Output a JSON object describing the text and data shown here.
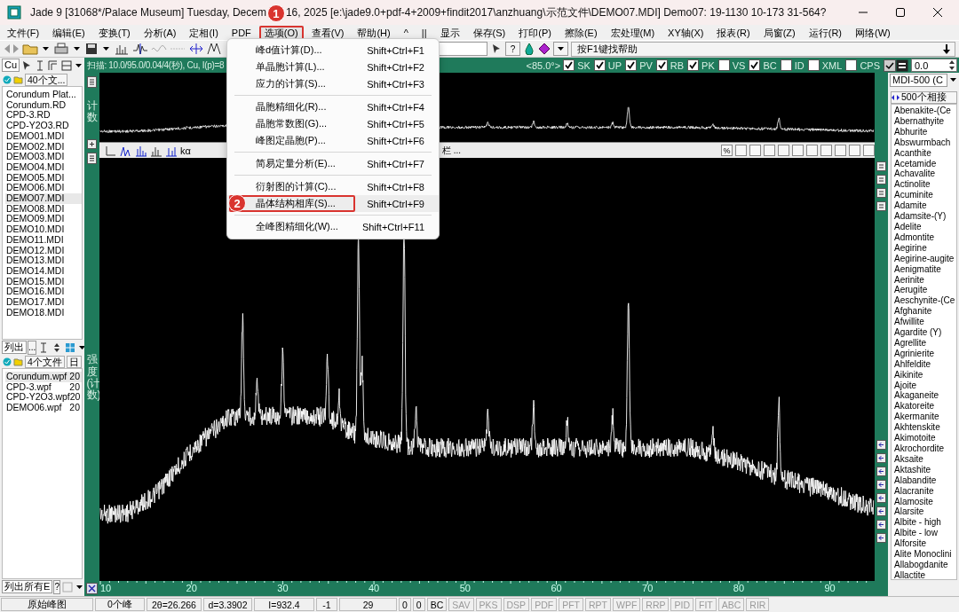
{
  "window": {
    "title": "Jade 9 [31068*/Palace Museum] Tuesday, Decem",
    "title_rest": "16, 2025 [e:\\jade9.0+pdf-4+2009+findit2017\\anzhuang\\示范文件\\DEMO07.MDI] Demo07: 19-1130 10-173 31-564?"
  },
  "menu_bar": [
    {
      "label": "文件(F)",
      "selected": false
    },
    {
      "label": "编辑(E)",
      "selected": false
    },
    {
      "label": "变换(T)",
      "selected": false
    },
    {
      "label": "分析(A)",
      "selected": false
    },
    {
      "label": "定相(I)",
      "selected": false
    },
    {
      "label": "PDF",
      "selected": false
    },
    {
      "label": "选项(O)",
      "selected": true,
      "callout": "1"
    },
    {
      "label": "查看(V)",
      "selected": false
    },
    {
      "label": "帮助(H)",
      "selected": false
    },
    {
      "label": "^",
      "selected": false
    },
    {
      "label": "||",
      "selected": false
    },
    {
      "label": "显示",
      "selected": false
    },
    {
      "label": "保存(S)",
      "selected": false
    },
    {
      "label": "打印(P)",
      "selected": false
    },
    {
      "label": "擦除(E)",
      "selected": false
    },
    {
      "label": "宏处理(M)",
      "selected": false
    },
    {
      "label": "XY轴(X)",
      "selected": false
    },
    {
      "label": "报表(R)",
      "selected": false
    },
    {
      "label": "局窗(Z)",
      "selected": false
    },
    {
      "label": "运行(R)",
      "selected": false
    },
    {
      "label": "网络(W)",
      "selected": false
    }
  ],
  "toolbar": {
    "help_button": "?",
    "help_text": "按F1键找帮助"
  },
  "options_menu": [
    {
      "kind": "item",
      "label": "峰d值计算(D)...",
      "shortcut": "Shift+Ctrl+F1",
      "selected": false
    },
    {
      "kind": "item",
      "label": "单晶胞计算(L)...",
      "shortcut": "Shift+Ctrl+F2",
      "selected": false
    },
    {
      "kind": "item",
      "label": "应力的计算(S)...",
      "shortcut": "Shift+Ctrl+F3",
      "selected": false
    },
    {
      "kind": "separator"
    },
    {
      "kind": "item",
      "label": "晶胞精细化(R)...",
      "shortcut": "Shift+Ctrl+F4",
      "selected": false
    },
    {
      "kind": "item",
      "label": "晶胞常数图(G)...",
      "shortcut": "Shift+Ctrl+F5",
      "selected": false
    },
    {
      "kind": "item",
      "label": "峰图定晶胞(P)...",
      "shortcut": "Shift+Ctrl+F6",
      "selected": false
    },
    {
      "kind": "separator"
    },
    {
      "kind": "item",
      "label": "简易定量分析(E)...",
      "shortcut": "Shift+Ctrl+F7",
      "selected": false
    },
    {
      "kind": "separator"
    },
    {
      "kind": "item",
      "label": "衍射图的计算(C)...",
      "shortcut": "Shift+Ctrl+F8",
      "selected": false
    },
    {
      "kind": "item",
      "label": "晶体结构相库(S)...",
      "shortcut": "Shift+Ctrl+F9",
      "selected": true,
      "callout": "2"
    },
    {
      "kind": "separator"
    },
    {
      "kind": "item",
      "label": "全峰图精细化(W)...",
      "shortcut": "Shift+Ctrl+F11",
      "selected": false
    }
  ],
  "scan_bar": {
    "info": "扫描: 10.0/95.0/0.04/4(秒), Cu, I(p)=8",
    "angle": "<85.0°>",
    "toggles": [
      {
        "label": "SK",
        "checked": true
      },
      {
        "label": "UP",
        "checked": true
      },
      {
        "label": "PV",
        "checked": true
      },
      {
        "label": "RB",
        "checked": true
      },
      {
        "label": "PK",
        "checked": true
      },
      {
        "label": "VS",
        "checked": false
      },
      {
        "label": "BC",
        "checked": true
      },
      {
        "label": "ID",
        "checked": false
      },
      {
        "label": "XML",
        "checked": false
      },
      {
        "label": "CPS",
        "checked": false
      }
    ],
    "value": "0.0"
  },
  "file_panel": {
    "radiation": "Cu",
    "header": "40个文...",
    "files": [
      {
        "name": "Corundum Plat...",
        "selected": false
      },
      {
        "name": "Corundum.RD",
        "selected": false
      },
      {
        "name": "CPD-3.RD",
        "selected": false
      },
      {
        "name": "CPD-Y2O3.RD",
        "selected": false
      },
      {
        "name": "DEMO01.MDI",
        "selected": false
      },
      {
        "name": "DEMO02.MDI",
        "selected": false
      },
      {
        "name": "DEMO03.MDI",
        "selected": false
      },
      {
        "name": "DEMO04.MDI",
        "selected": false
      },
      {
        "name": "DEMO05.MDI",
        "selected": false
      },
      {
        "name": "DEMO06.MDI",
        "selected": false
      },
      {
        "name": "DEMO07.MDI",
        "selected": true
      },
      {
        "name": "DEMO08.MDI",
        "selected": false
      },
      {
        "name": "DEMO09.MDI",
        "selected": false
      },
      {
        "name": "DEMO10.MDI",
        "selected": false
      },
      {
        "name": "DEMO11.MDI",
        "selected": false
      },
      {
        "name": "DEMO12.MDI",
        "selected": false
      },
      {
        "name": "DEMO13.MDI",
        "selected": false
      },
      {
        "name": "DEMO14.MDI",
        "selected": false
      },
      {
        "name": "DEMO15.MDI",
        "selected": false
      },
      {
        "name": "DEMO16.MDI",
        "selected": false
      },
      {
        "name": "DEMO17.MDI",
        "selected": false
      },
      {
        "name": "DEMO18.MDI",
        "selected": false
      }
    ],
    "filter": "列出",
    "filter_button": "...",
    "pattern_header": "4个文件",
    "date_header": "日",
    "patterns": [
      {
        "name": "Corundum.wpf",
        "date": "20",
        "selected": true
      },
      {
        "name": "CPD-3.wpf",
        "date": "20",
        "selected": false
      },
      {
        "name": "CPD-Y2O3.wpf",
        "date": "20",
        "selected": false
      },
      {
        "name": "DEMO06.wpf",
        "date": "20",
        "selected": false
      }
    ],
    "bottom_filter": "列出所有E",
    "bottom_help": "?"
  },
  "chart": {
    "overview_label": "计数",
    "y_label": "强度(计数)",
    "toolbar_label": "kα",
    "toolbar_text": "栏 ...",
    "percent_button": "%",
    "x_ticks": [
      "10",
      "20",
      "30",
      "40",
      "50",
      "60",
      "70",
      "80",
      "90"
    ]
  },
  "phase_panel": {
    "database": "MDI-500 (C",
    "header": "500个相接",
    "phases": [
      "Abenakite-(Ce",
      "Abernathyite",
      "Abhurite",
      "Abswurmbach",
      "Acanthite",
      "Acetamide",
      "Achavalite",
      "Actinolite",
      "Acuminite",
      "Adamite",
      "Adamsite-(Y)",
      "Adelite",
      "Admontite",
      "Aegirine",
      "Aegirine-augite",
      "Aenigmatite",
      "Aerinite",
      "Aerugite",
      "Aeschynite-(Ce",
      "Afghanite",
      "Afwillite",
      "Agardite (Y)",
      "Agrellite",
      "Agrinierite",
      "Ahlfeldite",
      "Aikinite",
      "Ajoite",
      "Akaganeite",
      "Akatoreite",
      "Akermanite",
      "Akhtenskite",
      "Akimotoite",
      "Akrochordite",
      "Aksaite",
      "Aktashite",
      "Alabandite",
      "Alacranite",
      "Alamosite",
      "Alarsite",
      "Albite - high",
      "Albite - low",
      "Alforsite",
      "Alite Monoclini",
      "Allabogdanite",
      "Allactite"
    ]
  },
  "status_bar": [
    {
      "text": "原始峰图",
      "disabled": false
    },
    {
      "text": "0个峰",
      "disabled": false
    },
    {
      "text": "2θ=26.266",
      "disabled": false
    },
    {
      "text": "d=3.3902",
      "disabled": false
    },
    {
      "text": "I=932.4",
      "disabled": false
    },
    {
      "text": "-1",
      "disabled": false
    },
    {
      "text": "29",
      "disabled": false
    },
    {
      "text": "0",
      "disabled": false
    },
    {
      "text": "0",
      "disabled": false
    },
    {
      "text": "BC",
      "disabled": false
    },
    {
      "text": "SAV",
      "disabled": true
    },
    {
      "text": "PKS",
      "disabled": true
    },
    {
      "text": "DSP",
      "disabled": true
    },
    {
      "text": "PDF",
      "disabled": true
    },
    {
      "text": "PFT",
      "disabled": true
    },
    {
      "text": "RPT",
      "disabled": true
    },
    {
      "text": "WPF",
      "disabled": true
    },
    {
      "text": "RRP",
      "disabled": true
    },
    {
      "text": "PID",
      "disabled": true
    },
    {
      "text": "FIT",
      "disabled": true
    },
    {
      "text": "ABC",
      "disabled": true
    },
    {
      "text": "RIR",
      "disabled": true
    }
  ]
}
